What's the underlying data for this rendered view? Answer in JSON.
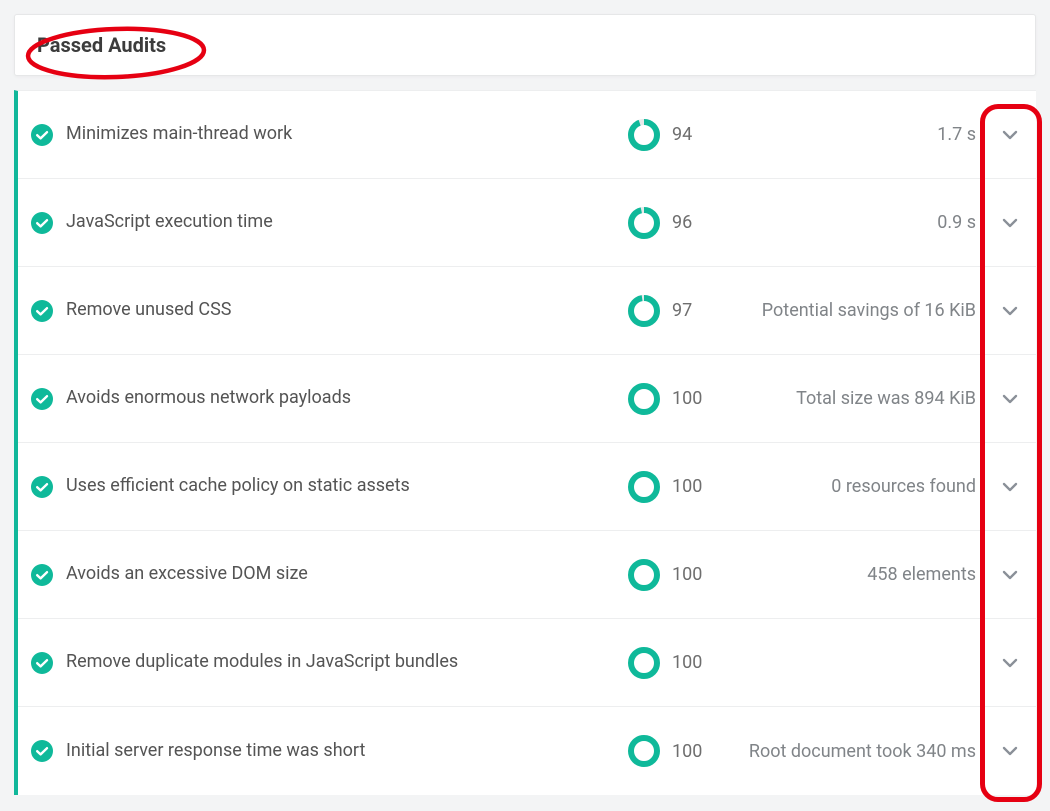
{
  "header": {
    "title": "Passed Audits"
  },
  "colors": {
    "pass": "#0fb99a",
    "donut": "#0fb99a",
    "annotation": "#e60012"
  },
  "audits": [
    {
      "title": "Minimizes main-thread work",
      "score": "94",
      "detail": "1.7 s"
    },
    {
      "title": "JavaScript execution time",
      "score": "96",
      "detail": "0.9 s"
    },
    {
      "title": "Remove unused CSS",
      "score": "97",
      "detail": "Potential savings of 16 KiB"
    },
    {
      "title": "Avoids enormous network payloads",
      "score": "100",
      "detail": "Total size was 894 KiB"
    },
    {
      "title": "Uses efficient cache policy on static assets",
      "score": "100",
      "detail": "0 resources found"
    },
    {
      "title": "Avoids an excessive DOM size",
      "score": "100",
      "detail": "458 elements"
    },
    {
      "title": "Remove duplicate modules in JavaScript bundles",
      "score": "100",
      "detail": ""
    },
    {
      "title": "Initial server response time was short",
      "score": "100",
      "detail": "Root document took 340 ms"
    }
  ]
}
